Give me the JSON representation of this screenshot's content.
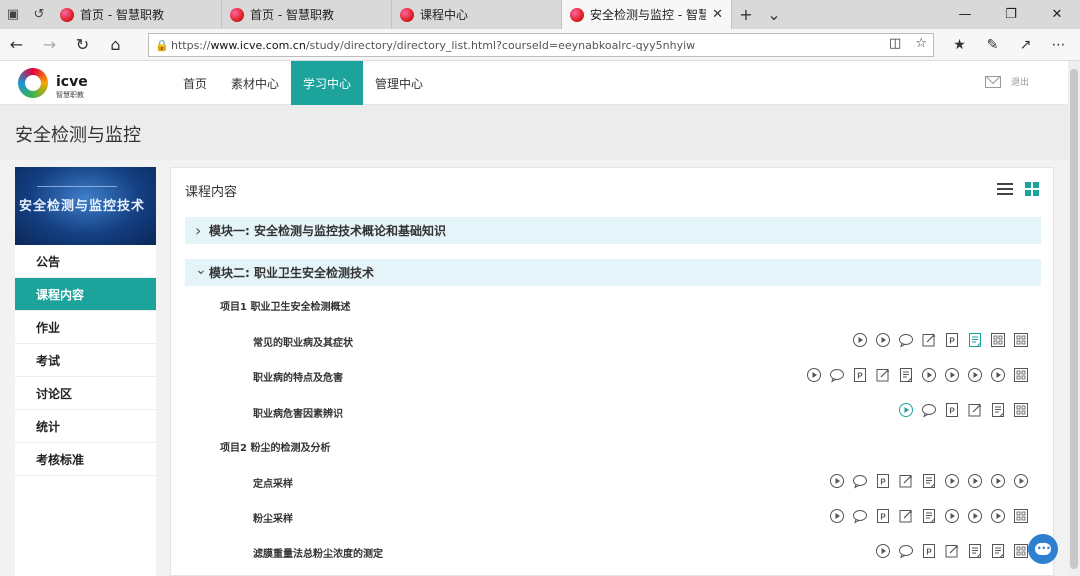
{
  "browser": {
    "tabs": [
      {
        "title": "首页 - 智慧职教",
        "active": false
      },
      {
        "title": "首页 - 智慧职教",
        "active": false
      },
      {
        "title": "课程中心",
        "active": false
      },
      {
        "title": "安全检测与监控 - 智慧",
        "active": true
      }
    ],
    "url_prefix": "https://",
    "url_host": "www.icve.com.cn",
    "url_path": "/study/directory/directory_list.html?courseId=eeynabkoalrc-qyy5nhyiw"
  },
  "site": {
    "logo_text": "icve",
    "logo_sub": "智慧职教",
    "nav": [
      "首页",
      "素材中心",
      "学习中心",
      "管理中心"
    ],
    "active_nav": "学习中心",
    "logout": "退出"
  },
  "page": {
    "title": "安全检测与监控"
  },
  "sidebar": {
    "banner_title": "安全检测与监控技术",
    "items": [
      "公告",
      "课程内容",
      "作业",
      "考试",
      "讨论区",
      "统计",
      "考核标准"
    ],
    "active_item": "课程内容"
  },
  "content": {
    "heading": "课程内容",
    "modules": [
      {
        "label": "模块一: 安全检测与监控技术概论和基础知识",
        "expanded": false
      },
      {
        "label": "模块二: 职业卫生安全检测技术",
        "expanded": true
      }
    ],
    "projects": [
      {
        "label": "项目1  职业卫生安全检测概述",
        "lessons": [
          {
            "label": "常见的职业病及其症状",
            "icons": [
              "play-icon",
              "play-icon",
              "comment-icon",
              "edit-icon",
              "ppt-icon",
              "doc-icon-teal",
              "grid-icon",
              "grid-icon"
            ]
          },
          {
            "label": "职业病的特点及危害",
            "icons": [
              "play-icon",
              "comment-icon",
              "ppt-icon",
              "edit-icon",
              "doc-icon",
              "play-icon",
              "play-icon",
              "play-icon",
              "play-icon",
              "grid-icon"
            ]
          },
          {
            "label": "职业病危害因素辨识",
            "icons": [
              "play-icon-teal",
              "comment-icon",
              "ppt-icon",
              "edit-icon",
              "doc-icon",
              "grid-icon"
            ]
          }
        ]
      },
      {
        "label": "项目2  粉尘的检测及分析",
        "lessons": [
          {
            "label": "定点采样",
            "icons": [
              "play-icon",
              "comment-icon",
              "ppt-icon",
              "edit-icon",
              "doc-icon",
              "play-icon",
              "play-icon",
              "play-icon",
              "play-icon"
            ]
          },
          {
            "label": "粉尘采样",
            "icons": [
              "play-icon",
              "comment-icon",
              "ppt-icon",
              "edit-icon",
              "doc-icon",
              "play-icon",
              "play-icon",
              "play-icon",
              "grid-icon"
            ]
          },
          {
            "label": "滤膜重量法总粉尘浓度的测定",
            "icons": [
              "play-icon",
              "comment-icon",
              "ppt-icon",
              "edit-icon",
              "doc-icon",
              "doc-icon",
              "grid-icon"
            ]
          }
        ]
      }
    ]
  },
  "colors": {
    "accent": "#1ba39c",
    "module_bg": "#e4f4f8",
    "chat": "#2f7fd1"
  }
}
